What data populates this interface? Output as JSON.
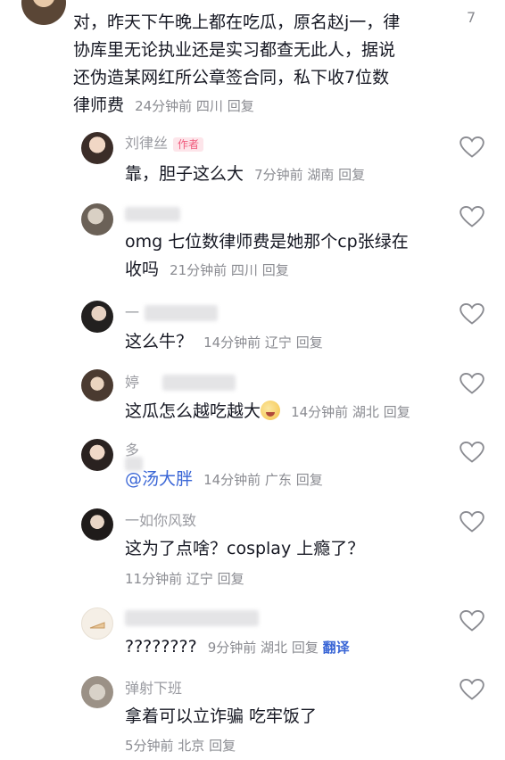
{
  "top_comment": {
    "text_lines": [
      "对，昨天下午晚上都在吃瓜，原名赵j一，律",
      "协库里无论执业还是实习都查无此人，据说",
      "还伪造某网红所公章签合同，私下收7位数"
    ],
    "text_last": "律师费",
    "meta": "24分钟前 四川",
    "reply": "回复",
    "like_count": "7"
  },
  "replies": [
    {
      "name": "刘律丝",
      "author_tag": "作者",
      "lines": [
        "靠，胆子这么大"
      ],
      "meta": "7分钟前 湖南",
      "reply": "回复"
    },
    {
      "name": "",
      "lines": [
        "omg 七位数律师费是她那个cp张绿在",
        "收吗"
      ],
      "meta": "21分钟前 四川",
      "reply": "回复"
    },
    {
      "name": "一",
      "lines": [
        "这么牛？"
      ],
      "meta": "14分钟前 辽宁",
      "reply": "回复"
    },
    {
      "name": "婷",
      "lines": [
        "这瓜怎么越吃越大"
      ],
      "meta": "14分钟前 湖北",
      "reply": "回复"
    },
    {
      "name": "多",
      "mention": "@汤大胖",
      "meta": "14分钟前 广东",
      "reply": "回复"
    },
    {
      "name": "一如你风致",
      "lines": [
        "这为了点啥？cosplay 上瘾了？"
      ],
      "meta": "11分钟前 辽宁",
      "reply": "回复"
    },
    {
      "name": "",
      "lines": [
        "????????"
      ],
      "meta": "9分钟前 湖北",
      "reply": "回复",
      "translate": "翻译"
    },
    {
      "name": "弹射下班",
      "lines": [
        "拿着可以立诈骗 吃牢饭了"
      ],
      "meta": "5分钟前 北京",
      "reply": "回复"
    }
  ],
  "icons": {
    "like": "heart-outline-icon",
    "reaction": "crying-face-emoji"
  }
}
